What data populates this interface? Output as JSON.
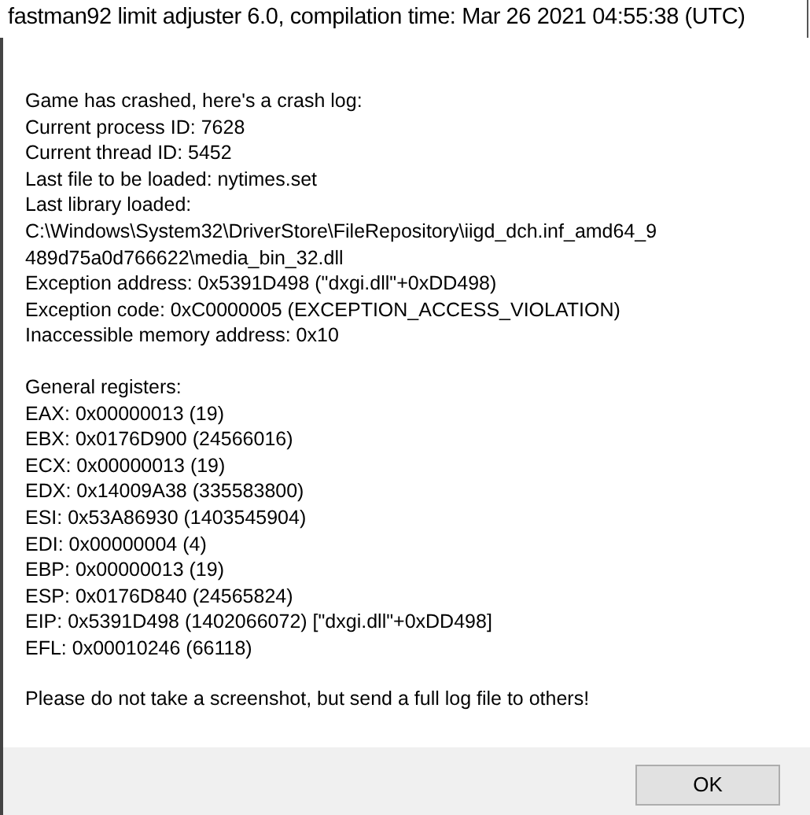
{
  "window": {
    "title": "fastman92 limit adjuster 6.0, compilation time: Mar 26 2021 04:55:38 (UTC)"
  },
  "message": {
    "paragraphs": [
      [
        "Game has crashed, here's a crash log:",
        "Current process ID: 7628",
        "Current thread ID: 5452",
        "Last file to be loaded: nytimes.set",
        "Last library loaded:",
        "C:\\Windows\\System32\\DriverStore\\FileRepository\\iigd_dch.inf_amd64_9",
        "489d75a0d766622\\media_bin_32.dll",
        "Exception address: 0x5391D498 (\"dxgi.dll\"+0xDD498)",
        "Exception code: 0xC0000005 (EXCEPTION_ACCESS_VIOLATION)",
        "Inaccessible memory address: 0x10"
      ],
      [
        "General registers:",
        "EAX: 0x00000013 (19)",
        "EBX: 0x0176D900 (24566016)",
        "ECX: 0x00000013 (19)",
        "EDX: 0x14009A38 (335583800)",
        "ESI: 0x53A86930 (1403545904)",
        "EDI: 0x00000004 (4)",
        "EBP: 0x00000013 (19)",
        "ESP: 0x0176D840 (24565824)",
        "EIP: 0x5391D498 (1402066072) [\"dxgi.dll\"+0xDD498]",
        "EFL: 0x00010246 (66118)"
      ],
      [
        "Please do not take a screenshot, but send a full log file to others!"
      ]
    ]
  },
  "buttons": [
    {
      "label": "OK"
    }
  ]
}
